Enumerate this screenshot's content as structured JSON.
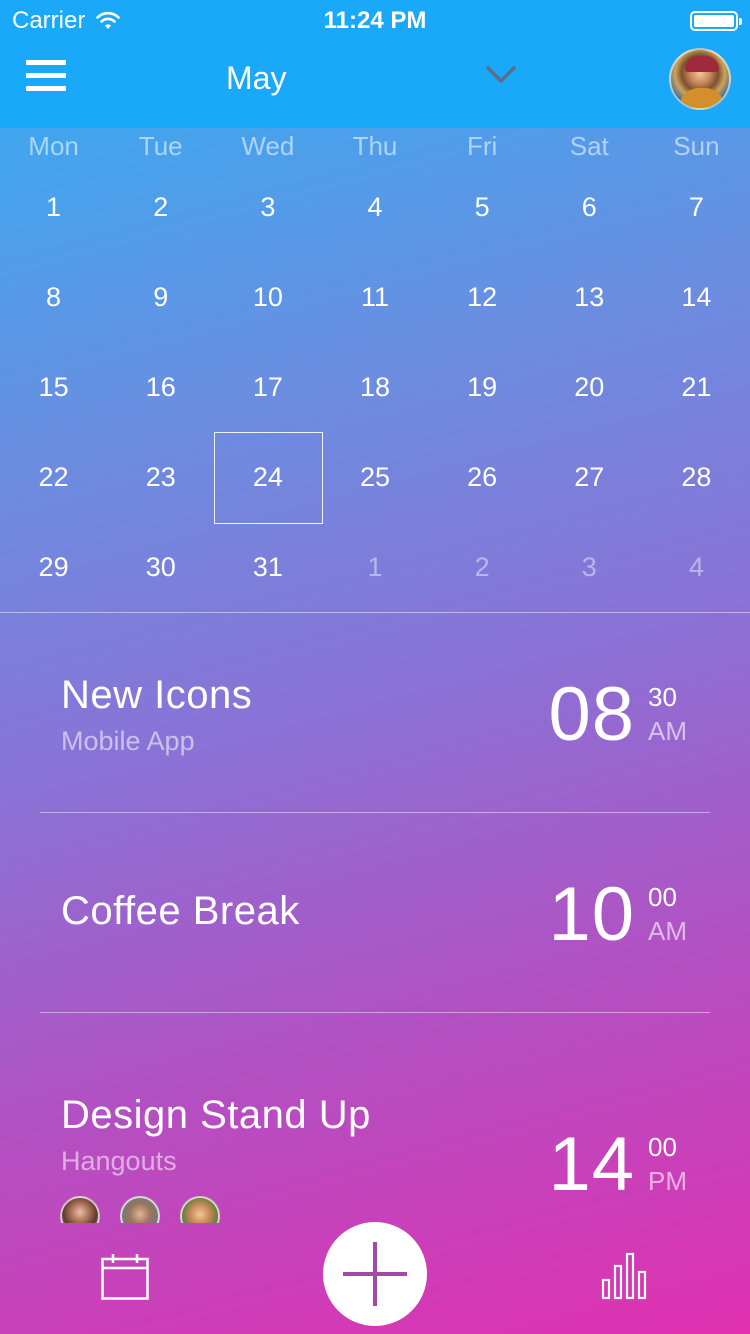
{
  "status_bar": {
    "carrier": "Carrier",
    "time": "11:24 PM"
  },
  "header": {
    "month": "May"
  },
  "calendar": {
    "weekdays": [
      "Mon",
      "Tue",
      "Wed",
      "Thu",
      "Fri",
      "Sat",
      "Sun"
    ],
    "weeks": [
      [
        {
          "d": "1"
        },
        {
          "d": "2"
        },
        {
          "d": "3"
        },
        {
          "d": "4"
        },
        {
          "d": "5"
        },
        {
          "d": "6"
        },
        {
          "d": "7"
        }
      ],
      [
        {
          "d": "8"
        },
        {
          "d": "9"
        },
        {
          "d": "10"
        },
        {
          "d": "11"
        },
        {
          "d": "12"
        },
        {
          "d": "13"
        },
        {
          "d": "14"
        }
      ],
      [
        {
          "d": "15"
        },
        {
          "d": "16"
        },
        {
          "d": "17"
        },
        {
          "d": "18"
        },
        {
          "d": "19"
        },
        {
          "d": "20"
        },
        {
          "d": "21"
        }
      ],
      [
        {
          "d": "22"
        },
        {
          "d": "23"
        },
        {
          "d": "24",
          "selected": true
        },
        {
          "d": "25"
        },
        {
          "d": "26"
        },
        {
          "d": "27"
        },
        {
          "d": "28"
        }
      ],
      [
        {
          "d": "29"
        },
        {
          "d": "30"
        },
        {
          "d": "31"
        },
        {
          "d": "1",
          "muted": true
        },
        {
          "d": "2",
          "muted": true
        },
        {
          "d": "3",
          "muted": true
        },
        {
          "d": "4",
          "muted": true
        }
      ]
    ]
  },
  "events": [
    {
      "title": "New Icons",
      "subtitle": "Mobile App",
      "hour": "08",
      "minute": "30",
      "ampm": "AM"
    },
    {
      "title": "Coffee Break",
      "subtitle": "",
      "hour": "10",
      "minute": "00",
      "ampm": "AM"
    },
    {
      "title": "Design Stand Up",
      "subtitle": "Hangouts",
      "hour": "14",
      "minute": "00",
      "ampm": "PM"
    }
  ],
  "colors": {
    "header": "#1aa8f8",
    "gradient_top": "#2fb0f5",
    "gradient_bottom": "#e030b0",
    "fab_plus": "#a24aa8"
  },
  "icons": {
    "menu": "menu-icon",
    "chevron": "chevron-down-icon",
    "calendar_tab": "calendar-icon",
    "add": "plus-icon",
    "stats_tab": "bar-chart-icon"
  }
}
